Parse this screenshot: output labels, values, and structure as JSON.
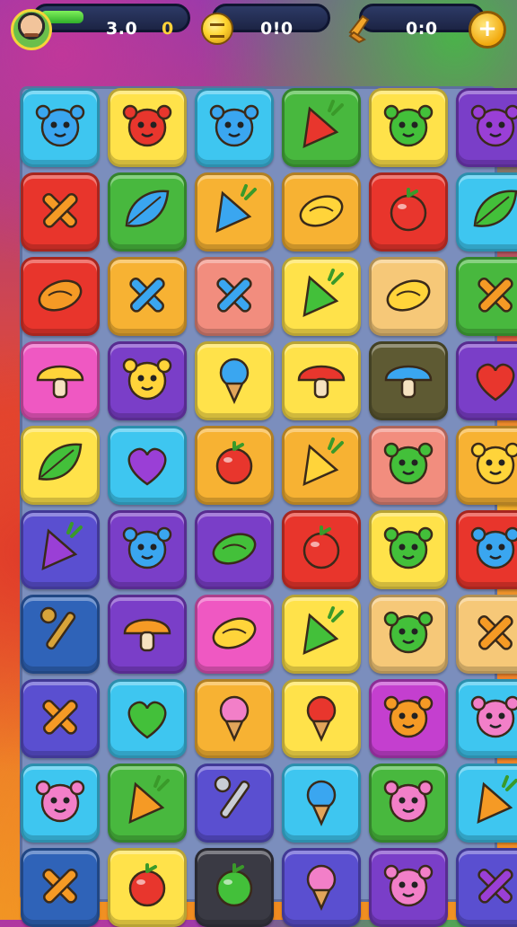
{
  "hud": {
    "player_score": "3.0",
    "player_extra": "0",
    "level_progress": 0.3,
    "coins": "0!0",
    "tools": "0:0",
    "plus_label": "+"
  },
  "colors": {
    "blue": "#3ec6f0",
    "yellow": "#ffe24a",
    "green": "#48b83e",
    "red": "#e8352c",
    "purple": "#7a3ec8",
    "orange": "#f7b233",
    "pink": "#ef58c2",
    "magenta": "#c43fcf",
    "peach": "#f6c878",
    "navy": "#2f63b8",
    "olive": "#5e5a33",
    "salmon": "#f28d7e",
    "violet": "#5a4fd0",
    "dark": "#3a3a44"
  },
  "board": {
    "rows": [
      [
        {
          "bg": "blue",
          "icon": "blue-cat-creature-icon"
        },
        {
          "bg": "yellow",
          "icon": "red-bear-creature-icon"
        },
        {
          "bg": "blue",
          "icon": "blue-beetle-icon"
        },
        {
          "bg": "green",
          "icon": "red-carrot-icon"
        },
        {
          "bg": "yellow",
          "icon": "green-turtle-icon"
        },
        {
          "bg": "purple",
          "icon": "purple-berry-creature-icon"
        }
      ],
      [
        {
          "bg": "red",
          "icon": "orange-bone-cross-icon"
        },
        {
          "bg": "green",
          "icon": "blue-leaf-icon"
        },
        {
          "bg": "orange",
          "icon": "blue-pepper-icon"
        },
        {
          "bg": "orange",
          "icon": "yellow-onion-icon"
        },
        {
          "bg": "red",
          "icon": "red-tomato-icon"
        },
        {
          "bg": "blue",
          "icon": "green-leaf-icon"
        }
      ],
      [
        {
          "bg": "red",
          "icon": "orange-bread-icon"
        },
        {
          "bg": "orange",
          "icon": "blue-cross-icon"
        },
        {
          "bg": "salmon",
          "icon": "blue-crossed-sticks-icon"
        },
        {
          "bg": "yellow",
          "icon": "green-cone-icon"
        },
        {
          "bg": "peach",
          "icon": "yellow-shell-icon"
        },
        {
          "bg": "green",
          "icon": "orange-cross-icon"
        }
      ],
      [
        {
          "bg": "pink",
          "icon": "yellow-mushroom-cap-icon"
        },
        {
          "bg": "purple",
          "icon": "yellow-flower-icon"
        },
        {
          "bg": "yellow",
          "icon": "blue-lollipop-icon"
        },
        {
          "bg": "yellow",
          "icon": "red-mushroom-icon"
        },
        {
          "bg": "olive",
          "icon": "blue-mushroom-icon"
        },
        {
          "bg": "purple",
          "icon": "red-heart-icon"
        }
      ],
      [
        {
          "bg": "yellow",
          "icon": "green-leaf-icon"
        },
        {
          "bg": "blue",
          "icon": "purple-heart-fruit-icon"
        },
        {
          "bg": "orange",
          "icon": "red-strawberry-icon"
        },
        {
          "bg": "orange",
          "icon": "yellow-carrot-icon"
        },
        {
          "bg": "salmon",
          "icon": "green-jelly-creature-icon"
        },
        {
          "bg": "orange",
          "icon": "yellow-star-creature-icon"
        }
      ],
      [
        {
          "bg": "violet",
          "icon": "purple-corn-icon"
        },
        {
          "bg": "purple",
          "icon": "blue-spiky-creature-icon"
        },
        {
          "bg": "purple",
          "icon": "green-pea-pod-icon"
        },
        {
          "bg": "red",
          "icon": "red-strawberry-icon"
        },
        {
          "bg": "yellow",
          "icon": "green-turtle-icon"
        },
        {
          "bg": "red",
          "icon": "blue-octopus-creature-icon"
        }
      ],
      [
        {
          "bg": "navy",
          "icon": "gold-key-icon"
        },
        {
          "bg": "purple",
          "icon": "orange-mushroom-icon"
        },
        {
          "bg": "pink",
          "icon": "yellow-pear-icon"
        },
        {
          "bg": "yellow",
          "icon": "green-cone-icon"
        },
        {
          "bg": "peach",
          "icon": "green-turtle-icon"
        },
        {
          "bg": "peach",
          "icon": "orange-crossed-sticks-icon"
        }
      ],
      [
        {
          "bg": "violet",
          "icon": "orange-crossed-sticks-icon"
        },
        {
          "bg": "blue",
          "icon": "green-heart-icon"
        },
        {
          "bg": "orange",
          "icon": "pink-icecream-icon"
        },
        {
          "bg": "yellow",
          "icon": "red-lollipop-icon"
        },
        {
          "bg": "magenta",
          "icon": "orange-sun-creature-icon"
        },
        {
          "bg": "blue",
          "icon": "pink-mouse-creature-icon"
        }
      ],
      [
        {
          "bg": "blue",
          "icon": "pink-bear-creature-icon"
        },
        {
          "bg": "green",
          "icon": "orange-radish-icon"
        },
        {
          "bg": "violet",
          "icon": "silver-wrench-icon"
        },
        {
          "bg": "blue",
          "icon": "blue-icecream-icon"
        },
        {
          "bg": "green",
          "icon": "pink-block-creature-icon"
        },
        {
          "bg": "blue",
          "icon": "orange-pepper-icon"
        }
      ],
      [
        {
          "bg": "navy",
          "icon": "orange-cross-icon"
        },
        {
          "bg": "yellow",
          "icon": "red-apple-icon"
        },
        {
          "bg": "dark",
          "icon": "green-bomb-icon"
        },
        {
          "bg": "violet",
          "icon": "pink-icecream-icon"
        },
        {
          "bg": "purple",
          "icon": "pink-puff-creature-icon"
        },
        {
          "bg": "violet",
          "icon": "purple-cross-icon"
        }
      ]
    ]
  }
}
